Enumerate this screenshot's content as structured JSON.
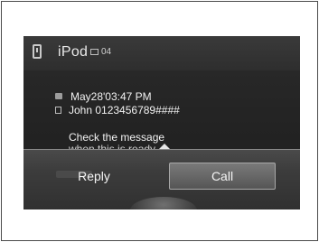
{
  "status_bar": {
    "source": "iPod",
    "track": "04"
  },
  "message": {
    "date": "May28'03:47 PM",
    "sender": "John 0123456789####",
    "body": "Check the message",
    "body_clipped": "when this is ready"
  },
  "popup": {
    "reply_label": "Reply",
    "call_label": "Call",
    "selected": "Call"
  }
}
